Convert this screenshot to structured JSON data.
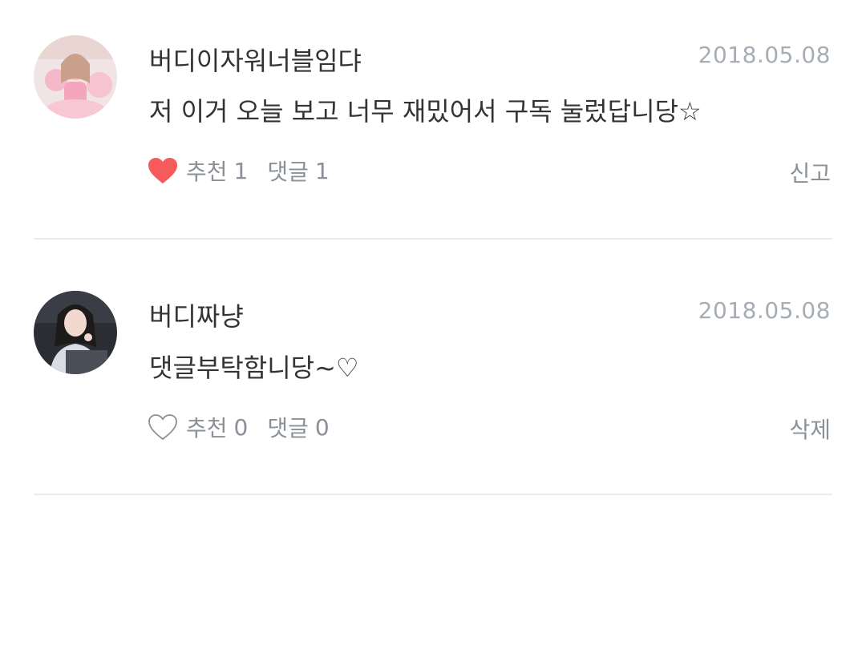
{
  "comments": [
    {
      "author": "버디이자워너블임댜",
      "date": "2018.05.08",
      "text": "저 이거 오늘 보고 너무 재밌어서 구독 눌렀답니당☆",
      "like_label": "추천",
      "like_count": "1",
      "liked": true,
      "reply_label": "댓글",
      "reply_count": "1",
      "side_action": "신고",
      "avatar_icon": "profile-photo-pink"
    },
    {
      "author": "버디짜냥",
      "date": "2018.05.08",
      "text": "댓글부탁함니당~♡",
      "like_label": "추천",
      "like_count": "0",
      "liked": false,
      "reply_label": "댓글",
      "reply_count": "0",
      "side_action": "삭제",
      "avatar_icon": "profile-photo-dark"
    }
  ],
  "colors": {
    "heart_liked": "#f65a5b",
    "muted_text": "#8a9097",
    "date_text": "#a7adb4",
    "divider": "#e8eaec"
  }
}
